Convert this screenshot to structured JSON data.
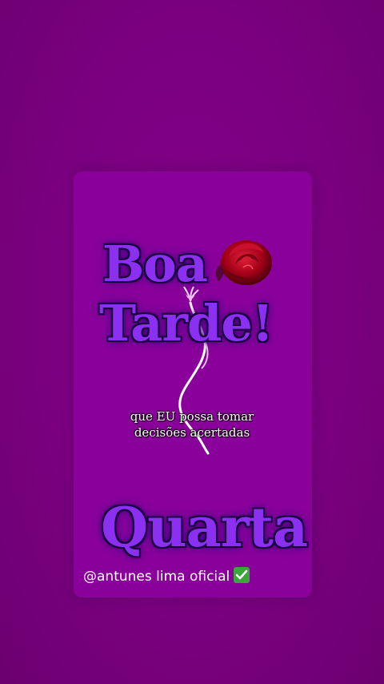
{
  "greeting": {
    "line1": "Boa",
    "line2": "Tarde!"
  },
  "phrase": {
    "line1": "que EU possa tomar",
    "line2": "decisões acertadas"
  },
  "weekday": "Quarta",
  "footer": {
    "handle": "@antunes lima oficial",
    "verified_icon": "check-mark-icon"
  },
  "colors": {
    "background": "#760079",
    "card": "#8a009a",
    "title_fill": "#8b2ff0",
    "title_outline": "#1a0040",
    "rose": "#b3001b"
  },
  "icons": {
    "rose": "rose-icon",
    "stem": "flower-stem-icon"
  }
}
